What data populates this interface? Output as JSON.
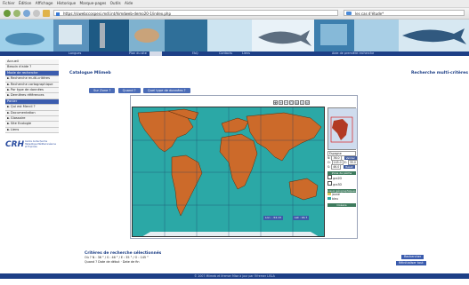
{
  "browser": {
    "menu": [
      "Fichier",
      "Édition",
      "Affichage",
      "Historique",
      "Marque-pages",
      "Outils",
      "Aide"
    ],
    "url": "https://siwebccospesi.mdl.int/himdweb-demo20-1/index.php",
    "search_value": "les cas d'étude*"
  },
  "bluenav": {
    "items": [
      "Langues",
      "Plan du site",
      "",
      "FAQ",
      "Contacts",
      "Liens",
      "Aide de première recherche"
    ]
  },
  "sidebar": {
    "items": [
      {
        "label": "Accueil",
        "highlight": false
      },
      {
        "label": "Besoin d'aide ?",
        "highlight": false
      },
      {
        "label": "Mode de recherche",
        "highlight": true
      },
      {
        "label": "► Recherche multi-critères",
        "highlight": false
      },
      {
        "label": "► Recherche cartographique",
        "highlight": false
      },
      {
        "label": "► Par type de données",
        "highlight": false
      },
      {
        "label": "► Dernières références",
        "highlight": false
      },
      {
        "label": "Panier",
        "highlight": true
      },
      {
        "label": "► Qui est Mercil ?",
        "highlight": false
      },
      {
        "label": "► Documentation",
        "highlight": false
      },
      {
        "label": "► Glossaire",
        "highlight": false
      },
      {
        "label": "► Site Ecologie",
        "highlight": false
      },
      {
        "label": "► Liens",
        "highlight": false
      }
    ],
    "logo_text": "CRH",
    "logo_sub": "Centre de Recherche Halieutique Méditerranéenne et Tropicale"
  },
  "main": {
    "title": "Catalogue Mlimeb",
    "right_title": "Recherche multi-critères",
    "tabs": [
      "Sur Zone ?",
      "Quand ?",
      "Quel type de données ?"
    ]
  },
  "map_panel": {
    "field_label": "Espagne",
    "n_label": "N:",
    "n_value": "36.0",
    "w_label": "O:",
    "w_value": "145.0",
    "e_label": "E:",
    "e_value": "35.0",
    "s_label": "S:",
    "s_value": "46.0",
    "btn_valider": "Valider",
    "btn_reset": "Reset",
    "sec1": "Zone de pêche",
    "sec2": "Lieux géographiques",
    "sec3": "Océans",
    "legend_items": [
      "gcs2D",
      "gcs3D",
      "jaune",
      "bleu"
    ],
    "coord_left": "Lon : -54.13",
    "coord_right": "Lat : 16.7"
  },
  "criteria": {
    "heading": "Critères de recherche sélectionnés",
    "line1": "Où ? N : 36 ° / S : 46 ° / E : 35 ° / O : 145 °",
    "line2": "Quand ? Date de début · Date de fin"
  },
  "actions": {
    "rechercher": "Rechercher",
    "reinit": "Réinitialiser tout"
  },
  "footer": {
    "text": "© 2007 Mlimeb et Ifremer Mise à jour par l'Ifremer LISLA"
  },
  "colors": {
    "ocean": "#2ba8a6",
    "land": "#cc6a2a",
    "navy": "#1d3f86",
    "accent": "#3b5cae"
  }
}
